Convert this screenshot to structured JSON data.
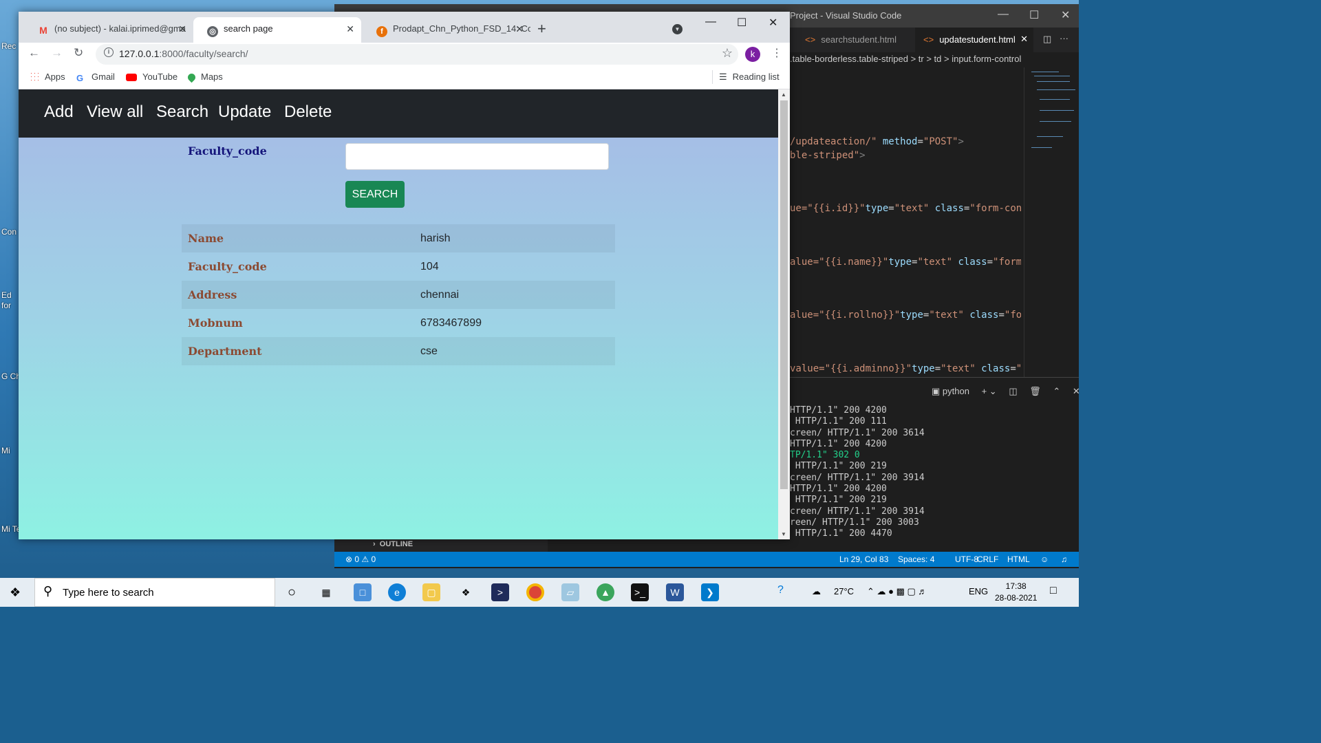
{
  "desktop": {
    "icon_labels": [
      "Rec",
      "Con",
      "Ed for",
      "G Ch",
      "Mi",
      "Mi Teams"
    ]
  },
  "vscode": {
    "title": "Project - Visual Studio Code",
    "tabs": [
      {
        "label": "searchstudent.html",
        "active": false
      },
      {
        "label": "updatestudent.html",
        "active": true
      }
    ],
    "breadcrumb": ".table-borderless.table-striped  >  tr  >  td  >  input.form-control",
    "code_lines": [
      {
        "parts": [
          {
            "t": "/updateaction/\"",
            "c": "str"
          },
          {
            "t": " method",
            "c": "attr"
          },
          {
            "t": "=",
            "c": "plain"
          },
          {
            "t": "\"POST\"",
            "c": "str"
          },
          {
            "t": ">",
            "c": "tag"
          }
        ]
      },
      {
        "parts": [
          {
            "t": "ble-striped\"",
            "c": "str"
          },
          {
            "t": ">",
            "c": "tag"
          }
        ]
      },
      {
        "parts": [
          {
            "t": "ue=\"{{i.id}}\"",
            "c": "str"
          },
          {
            "t": "type",
            "c": "attr"
          },
          {
            "t": "=",
            "c": "plain"
          },
          {
            "t": "\"text\"",
            "c": "str"
          },
          {
            "t": " class",
            "c": "attr"
          },
          {
            "t": "=",
            "c": "plain"
          },
          {
            "t": "\"form-contro",
            "c": "str"
          }
        ]
      },
      {
        "parts": [
          {
            "t": "alue=\"{{i.name}}\"",
            "c": "str"
          },
          {
            "t": "type",
            "c": "attr"
          },
          {
            "t": "=",
            "c": "plain"
          },
          {
            "t": "\"text\"",
            "c": "str"
          },
          {
            "t": " class",
            "c": "attr"
          },
          {
            "t": "=",
            "c": "plain"
          },
          {
            "t": "\"form-co",
            "c": "str"
          }
        ]
      },
      {
        "parts": [
          {
            "t": "alue=\"{{i.rollno}}\"",
            "c": "str"
          },
          {
            "t": "type",
            "c": "attr"
          },
          {
            "t": "=",
            "c": "plain"
          },
          {
            "t": "\"text\"",
            "c": "str"
          },
          {
            "t": " class",
            "c": "attr"
          },
          {
            "t": "=",
            "c": "plain"
          },
          {
            "t": "\"form-",
            "c": "str"
          }
        ]
      },
      {
        "parts": [
          {
            "t": "value=\"{{i.adminno}}\"",
            "c": "str"
          },
          {
            "t": "type",
            "c": "attr"
          },
          {
            "t": "=",
            "c": "plain"
          },
          {
            "t": "\"text\"",
            "c": "str"
          },
          {
            "t": " class",
            "c": "attr"
          },
          {
            "t": "=",
            "c": "plain"
          },
          {
            "t": "\"for",
            "c": "str"
          }
        ]
      }
    ],
    "terminal_label": "python",
    "terminal_lines": [
      {
        "text": "HTTP/1.1\" 200 4200",
        "green": false
      },
      {
        "text": " HTTP/1.1\" 200 111",
        "green": false
      },
      {
        "text": "creen/ HTTP/1.1\" 200 3614",
        "green": false
      },
      {
        "text": "HTTP/1.1\" 200 4200",
        "green": false
      },
      {
        "text": "TP/1.1\" 302 0",
        "green": true
      },
      {
        "text": " HTTP/1.1\" 200 219",
        "green": false
      },
      {
        "text": "creen/ HTTP/1.1\" 200 3914",
        "green": false
      },
      {
        "text": "HTTP/1.1\" 200 4200",
        "green": false
      },
      {
        "text": " HTTP/1.1\" 200 219",
        "green": false
      },
      {
        "text": "creen/ HTTP/1.1\" 200 3914",
        "green": false
      },
      {
        "text": "reen/ HTTP/1.1\" 200 3003",
        "green": false
      },
      {
        "text": " HTTP/1.1\" 200 4470",
        "green": false
      }
    ],
    "outline_label": "OUTLINE",
    "status": {
      "problems": "⊗ 0 ⚠ 0",
      "position": "Ln 29, Col 83",
      "spaces": "Spaces: 4",
      "encoding": "UTF-8",
      "eol": "CRLF",
      "language": "HTML"
    }
  },
  "browser": {
    "tabs": [
      {
        "title": "(no subject) - kalai.iprimed@gma",
        "favicon": "M",
        "color": "#ea4335",
        "active": false
      },
      {
        "title": "search page",
        "favicon": "◎",
        "color": "#5f6368",
        "active": true
      },
      {
        "title": "Prodapt_Chn_Python_FSD_14: Co",
        "favicon": "f",
        "color": "#e8710a",
        "active": false
      }
    ],
    "url_host": "127.0.0.1",
    "url_path": ":8000/faculty/search/",
    "avatar_letter": "k",
    "bookmarks": [
      "Apps",
      "Gmail",
      "YouTube",
      "Maps"
    ],
    "reading_list": "Reading list"
  },
  "page": {
    "nav": [
      "Add",
      "View all",
      "Search",
      "Update",
      "Delete"
    ],
    "search_label": "Faculty_code",
    "search_value": "",
    "search_button": "SEARCH",
    "result": [
      {
        "key": "Name",
        "value": "harish"
      },
      {
        "key": "Faculty_code",
        "value": "104"
      },
      {
        "key": "Address",
        "value": "chennai"
      },
      {
        "key": "Mobnum",
        "value": "6783467899"
      },
      {
        "key": "Department",
        "value": "cse"
      }
    ]
  },
  "taskbar": {
    "search_placeholder": "Type here to search",
    "weather": "27°C",
    "language": "ENG",
    "time": "17:38",
    "date": "28-08-2021"
  }
}
